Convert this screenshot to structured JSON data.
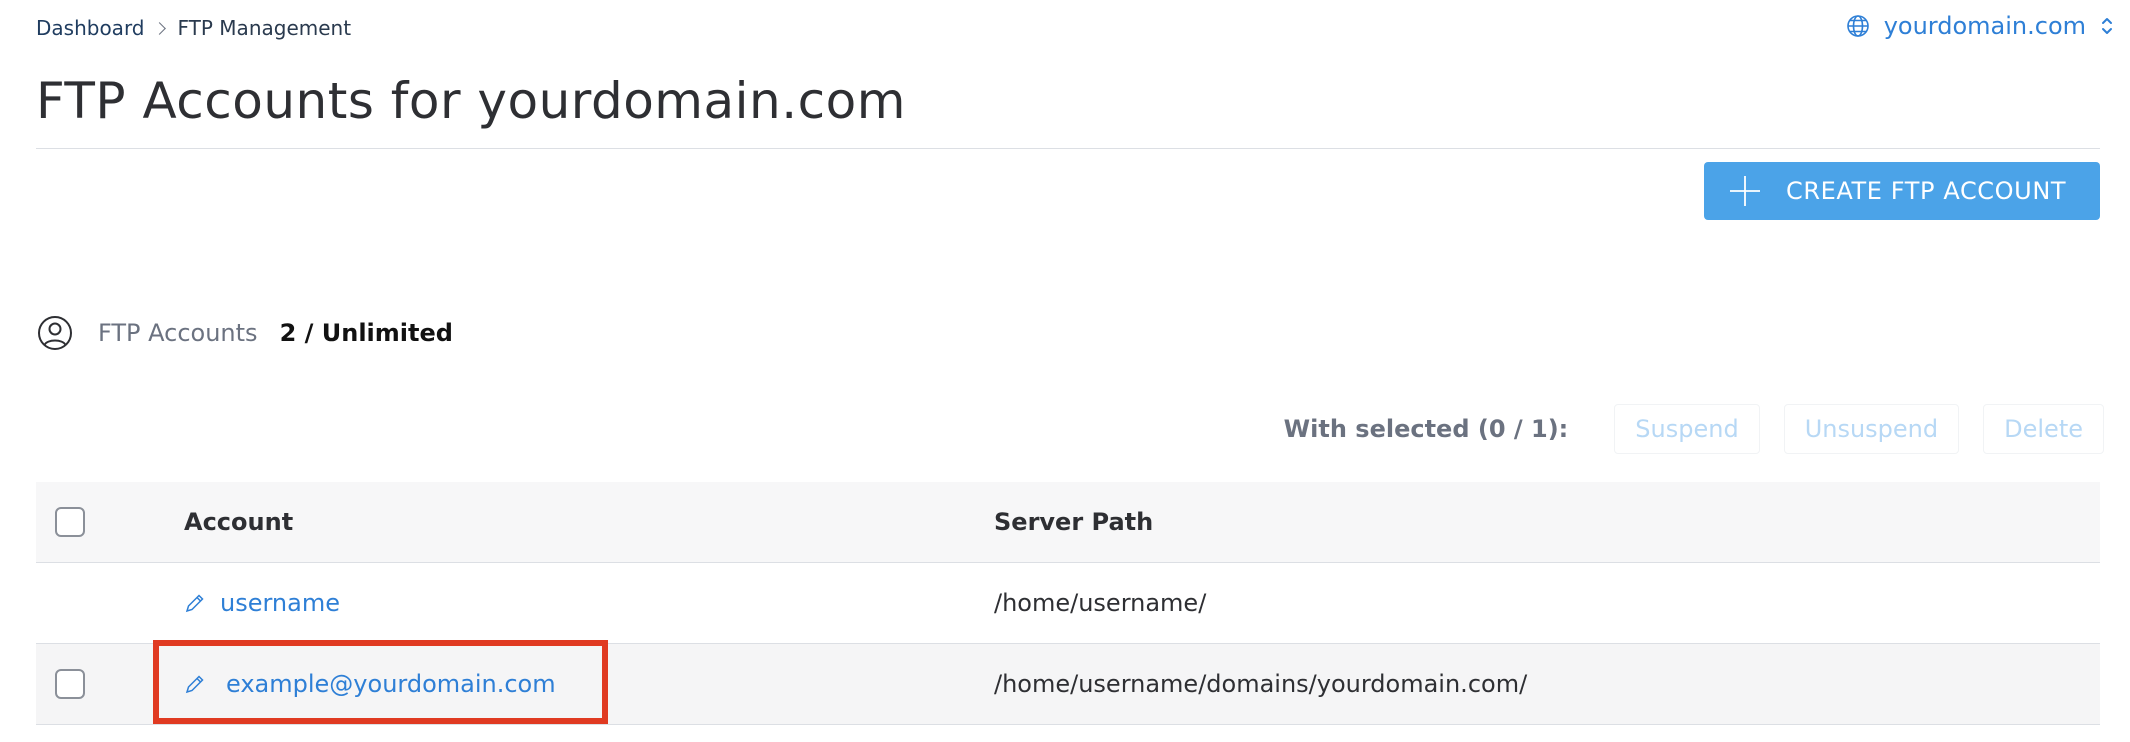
{
  "breadcrumb": {
    "items": [
      "Dashboard",
      "FTP Management"
    ]
  },
  "domain_switcher": {
    "label": "yourdomain.com",
    "icon": "globe-icon"
  },
  "page": {
    "title": "FTP Accounts for yourdomain.com"
  },
  "create_button": {
    "label": "CREATE FTP ACCOUNT",
    "icon": "plus-icon"
  },
  "usage": {
    "icon": "user-circle-icon",
    "label": "FTP Accounts",
    "value": "2 / Unlimited"
  },
  "bulk_actions": {
    "label": "With selected (0 / 1):",
    "buttons": [
      "Suspend",
      "Unsuspend",
      "Delete"
    ]
  },
  "table": {
    "columns": [
      "Account",
      "Server Path"
    ],
    "rows": [
      {
        "account": "username",
        "server_path": "/home/username/",
        "has_checkbox": false
      },
      {
        "account": "example@yourdomain.com",
        "server_path": "/home/username/domains/yourdomain.com/",
        "has_checkbox": true
      }
    ]
  },
  "colors": {
    "accent": "#2e7fd6",
    "button": "#4ba3e8",
    "highlight": "#e03a22"
  }
}
